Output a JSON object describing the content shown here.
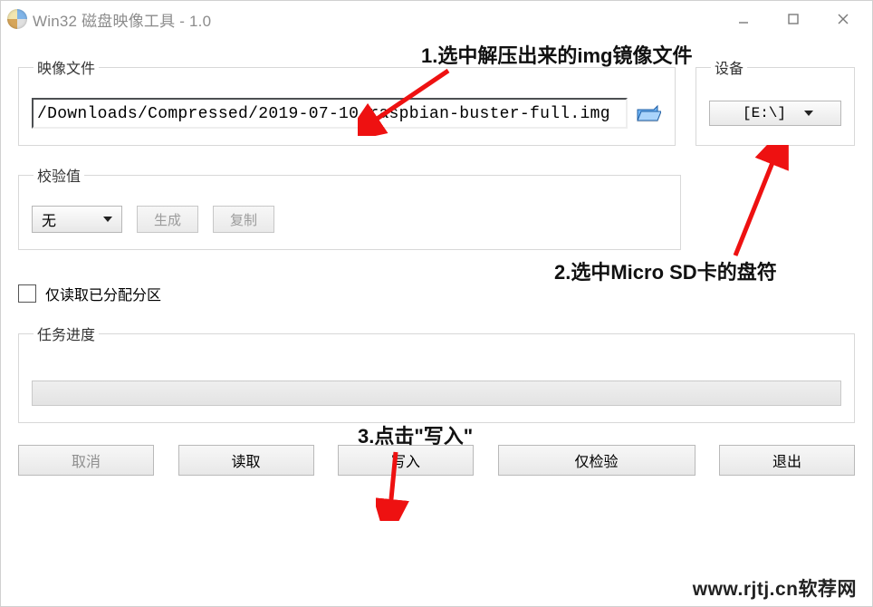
{
  "window": {
    "title": "Win32 磁盘映像工具 - 1.0"
  },
  "image_file": {
    "group_label": "映像文件",
    "path": "/Downloads/Compressed/2019-07-10-raspbian-buster-full.img"
  },
  "device": {
    "group_label": "设备",
    "selected": "[E:\\]"
  },
  "hash": {
    "group_label": "校验值",
    "mode": "无",
    "generate_label": "生成",
    "copy_label": "复制"
  },
  "read_allocated": {
    "label": "仅读取已分配分区",
    "checked": false
  },
  "progress": {
    "group_label": "任务进度"
  },
  "buttons": {
    "cancel": "取消",
    "read": "读取",
    "write": "写入",
    "verify": "仅检验",
    "exit": "退出"
  },
  "annotations": {
    "a1": "1.选中解压出来的img镜像文件",
    "a2": "2.选中Micro SD卡的盘符",
    "a3": "3.点击\"写入\"",
    "watermark": "www.rjtj.cn软荐网"
  }
}
